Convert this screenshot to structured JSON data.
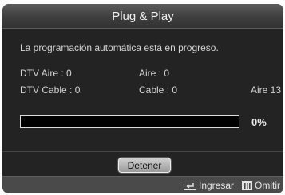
{
  "dialog": {
    "title": "Plug & Play",
    "message": "La programación automática está en progreso."
  },
  "channels": {
    "dtv_air": "DTV Aire : 0",
    "air": "Aire : 0",
    "dtv_cable": "DTV Cable : 0",
    "cable": "Cable : 0",
    "current_channel": "Aire 13"
  },
  "progress": {
    "value_percent": 0,
    "label": "0%"
  },
  "buttons": {
    "stop_label": "Detener"
  },
  "footer": {
    "enter_label": "Ingresar",
    "skip_label": "Omitir",
    "enter_icon": "enter-icon",
    "skip_icon": "exit-icon"
  }
}
